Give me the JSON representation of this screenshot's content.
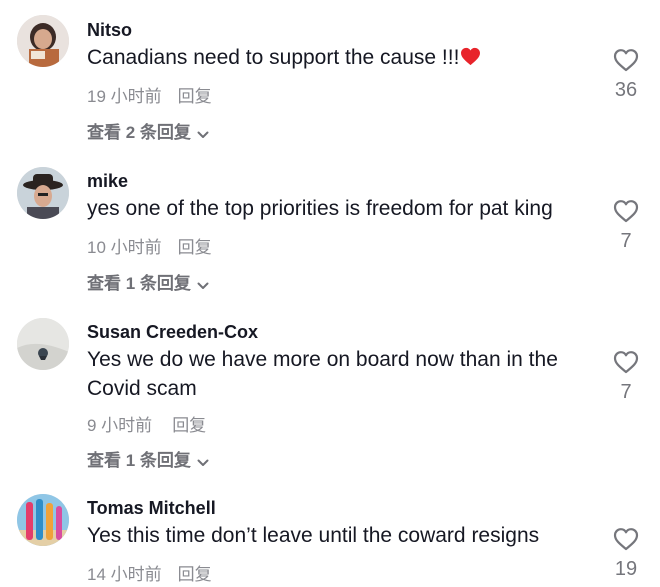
{
  "comments": [
    {
      "username": "Nitso",
      "text": "Canadians need to support the cause !!!",
      "emoji": "red-heart",
      "time": "19 小时前",
      "reply_label": "回复",
      "likes": "36",
      "view_replies": "查看 2 条回复"
    },
    {
      "username": "mike",
      "text": "yes one of the top priorities is freedom for pat king",
      "time": "10 小时前",
      "reply_label": "回复",
      "likes": "7",
      "view_replies": "查看 1 条回复"
    },
    {
      "username": "Susan Creeden-Cox",
      "text": "Yes we do we have more on board now than in the Covid scam",
      "time": "9 小时前",
      "reply_label": "回复",
      "likes": "7",
      "view_replies": "查看 1 条回复"
    },
    {
      "username": "Tomas Mitchell",
      "text": "Yes this time don’t leave until the coward resigns",
      "time": "14 小时前",
      "reply_label": "回复",
      "likes": "19"
    }
  ],
  "colors": {
    "username": "#161823",
    "meta": "#8a8b91",
    "view_replies": "#6f7076",
    "emoji_heart": "#e8242b"
  }
}
